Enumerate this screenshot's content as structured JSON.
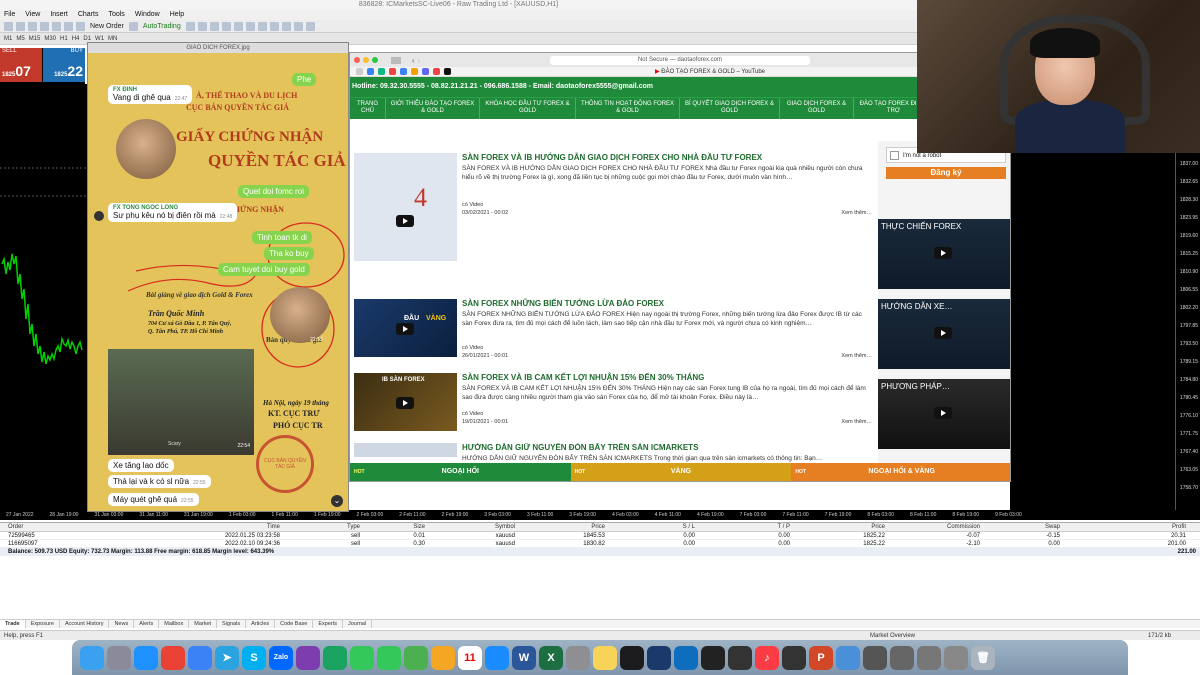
{
  "mt4": {
    "title": "836828: ICMarketsSC-Live06 - Raw Trading Ltd - [XAUUSD,H1]",
    "menu": [
      "File",
      "View",
      "Insert",
      "Charts",
      "Tools",
      "Window",
      "Help"
    ],
    "toolbar": {
      "new_order": "New Order",
      "autotrading": "AutoTrading"
    },
    "timeframes": [
      "M1",
      "M5",
      "M15",
      "M30",
      "H1",
      "H4",
      "D1",
      "W1",
      "MN"
    ],
    "oneclick": {
      "sell_label": "SELL",
      "buy_label": "BUY",
      "lot": "0.01",
      "sell_small": "1825",
      "sell_big": "07",
      "buy_small": "1825",
      "buy_big": "22"
    },
    "price_axis": [
      "1837.00",
      "1832.65",
      "1828.30",
      "1823.95",
      "1819.60",
      "1815.25",
      "1810.90",
      "1806.55",
      "1802.20",
      "1797.85",
      "1793.50",
      "1789.15",
      "1784.80",
      "1780.45",
      "1776.10",
      "1771.75",
      "1767.40",
      "1763.05",
      "1758.70"
    ],
    "time_axis": [
      "27 Jan 2022",
      "28 Jan 19:00",
      "31 Jan 03:00",
      "31 Jan 11:00",
      "31 Jan 19:00",
      "1 Feb 03:00",
      "1 Feb 11:00",
      "1 Feb 19:00",
      "2 Feb 03:00",
      "2 Feb 11:00",
      "2 Feb 19:00",
      "3 Feb 03:00",
      "3 Feb 11:00",
      "3 Feb 19:00",
      "4 Feb 03:00",
      "4 Feb 11:00",
      "4 Feb 19:00",
      "7 Feb 03:00",
      "7 Feb 11:00",
      "7 Feb 19:00",
      "8 Feb 03:00",
      "8 Feb 11:00",
      "8 Feb 19:00",
      "9 Feb 03:00"
    ],
    "terminal": {
      "headers": [
        "Order",
        "Time",
        "Type",
        "Size",
        "Symbol",
        "Price",
        "S / L",
        "T / P",
        "Price",
        "Commission",
        "Swap",
        "Profit"
      ],
      "rows": [
        [
          "72599465",
          "2022.01.25 03:23:58",
          "sell",
          "0.01",
          "xauusd",
          "1845.53",
          "0.00",
          "0.00",
          "1825.22",
          "-0.07",
          "-0.15",
          "20.31"
        ],
        [
          "116695097",
          "2022.02.10 09:24:36",
          "sell",
          "0.30",
          "xauusd",
          "1830.82",
          "0.00",
          "0.00",
          "1825.22",
          "-2.10",
          "0.00",
          "201.00"
        ]
      ],
      "balance": "Balance: 509.73 USD  Equity: 732.73  Margin: 113.88  Free margin: 618.85  Margin level: 643.39%",
      "balance_profit": "221.00",
      "tabs": [
        "Trade",
        "Exposure",
        "Account History",
        "News",
        "Alerts",
        "Mailbox",
        "Market",
        "Signals",
        "Articles",
        "Code Base",
        "Experts",
        "Journal"
      ]
    },
    "status": "Help, press F1",
    "status_right": "Market Overview",
    "status_far": "171/2 kb"
  },
  "photo": {
    "title": "GIAO DICH FOREX.jpg",
    "cert_line1": "À, THỂ THAO VÀ DU LỊCH",
    "cert_line2": "CỤC BẢN QUYỀN TÁC GIẢ",
    "cert_line3": "GIẤY CHỨNG NHẬN",
    "cert_line4": "QUYỀN TÁC GIẢ",
    "cert_line5": "CHỨNG NHẬN",
    "cert_line6": "Bài giảng về giao dịch Gold & Forex",
    "cert_line7": "Trần Quốc Minh",
    "cert_line8": "704 Cư xá Gò Dầu 1, P. Tân Quý,",
    "cert_line9": "Q. Tân Phú, TP. Hồ Chí Minh",
    "cert_line10": "Bản quyền Tác giả",
    "cert_line11": "Hà Nội, ngày 19 tháng",
    "cert_line12": "KT. CỤC TRƯ",
    "cert_line13": "PHÓ CỤC TR",
    "stamp": "CỤC BẢN QUYỀN TÁC GIẢ",
    "chat": {
      "top_right": "Phe",
      "m1_name": "FX ĐINH",
      "m1_text": "Vang di ghê qua",
      "m1_time": "22:47",
      "m2_text": "Quet doi fomc roi",
      "m3_name": "FX TONG NGOC LONG",
      "m3_text": "Sư phụ kêu nó bị điên rồi mà",
      "m3_time": "22:48",
      "m4_text": "Tinh toan tk di",
      "m5_text": "Tha ko buy",
      "m6_text": "Cam tuyet doi buy gold",
      "m7_time": "22:53",
      "video_time": "22:54",
      "video_label": "Scary",
      "m8_text": "Xe tăng lao dốc",
      "m9_text": "Thả lại và k có sl nữa",
      "m9_time": "22:55",
      "m10_text": "Máy quét ghê quá",
      "m10_time": "22:55"
    }
  },
  "browser": {
    "url": "Not Secure — daotaoforex.com",
    "yt_tab": "ĐÀO TẠO FOREX & GOLD – YouTube",
    "hotline": "Hotline: 09.32.30.5555 - 08.82.21.21.21 - 096.686.1588 - Email: daotaoforex5555@gmail.com",
    "nav": [
      "TRANG CHỦ",
      "GIỚI THIỆU ĐÀO TẠO FOREX & GOLD",
      "KHÓA HỌC ĐẦU TƯ FOREX & GOLD",
      "THÔNG TIN HOẠT ĐỘNG FOREX & GOLD",
      "BÍ QUYẾT GIAO DỊCH FOREX & GOLD",
      "GIAO DỊCH FOREX & GOLD",
      "ĐÀO TẠO FOREX ĐI HỖ TRỢ"
    ],
    "articles": [
      {
        "title": "SÀN FOREX VÀ IB HƯỚNG DẪN GIAO DỊCH FOREX CHO NHÀ ĐẦU TƯ FOREX",
        "body": "SÀN FOREX VÀ IB HƯỚNG DẪN GIAO DỊCH FOREX CHO NHÀ ĐẦU TƯ FOREX Nhà đầu tư Forex ngoài kia quá nhiều người còn chưa hiểu rõ về thị trường Forex là gì, xong đã liền tục bị những cuộc gọi mời chào đầu tư Forex, dưới muôn vàn hình…",
        "type": "có Video",
        "date": "03/02/2021 - 00:02",
        "more": "Xem thêm…"
      },
      {
        "title": "SÀN FOREX NHỮNG BIẾN TƯỚNG LỪA ĐẢO FOREX",
        "body": "SÀN FOREX NHỮNG BIẾN TƯỚNG LỪA ĐẢO FOREX  Hiện nay ngoài thị trường Forex, những biến tướng lừa đảo Forex được IB từ các sàn Forex đưa ra, tìm đủ mọi cách để luồn lách, làm sao tiếp cận nhà đầu tư Forex mới, và người chưa có kinh nghiệm…",
        "type": "có Video",
        "date": "26/01/2021 - 00:01",
        "more": "Xem thêm…",
        "thumb_word1": "ĐẦU",
        "thumb_word2": "VÀNG"
      },
      {
        "title": "SÀN FOREX VÀ IB CAM KẾT LỢI NHUẬN 15% ĐẾN 30% THÁNG",
        "body": "SÀN FOREX VÀ IB CAM KẾT LỢI NHUẬN 15% ĐẾN 30% THÁNG  Hiện nay các sàn Forex tung IB của họ ra ngoài, tìm đủ mọi cách để làm sao đưa được càng nhiều người tham gia vào sàn Forex của họ, để mở tài khoản Forex. Điều này là…",
        "type": "có Video",
        "date": "19/01/2021 - 00:01",
        "more": "Xem thêm…",
        "thumb_word1": "IB SÀN FOREX"
      },
      {
        "title": "HƯỚNG DẪN GIỮ NGUYÊN ĐÒN BẨY TRÊN SÀN ICMARKETS",
        "body": "HƯỚNG DẪN GIỮ NGUYÊN ĐÒN BẨY TRÊN SÀN ICMARKETS  Trong thời gian qua trên sàn icmarkets có thông tin: Bạn…"
      }
    ],
    "thumb1_number": "4",
    "captcha": "I'm not a robot",
    "register": "Đăng ký",
    "side_videos": [
      "THỰC CHIẾN FOREX",
      "HƯỚNG DẪN XE…",
      "PHƯƠNG PHÁP…"
    ],
    "bottom": [
      "NGOẠI HỐI",
      "VÀNG",
      "NGOẠI HỐI & VÀNG"
    ],
    "bottom_badge": "HOT"
  },
  "dock": {
    "icons": [
      "finder-icon",
      "launchpad-icon",
      "safari-icon",
      "chrome-icon",
      "edge-icon",
      "telegram-icon",
      "skype-icon",
      "zalo-icon",
      "viber-icon",
      "stacks-icon",
      "facetime-icon",
      "messages-icon",
      "maps-icon",
      "photos-icon",
      "calendar-icon",
      "appstore-icon",
      "word-icon",
      "excel-icon",
      "settings-icon",
      "notes-icon",
      "quicktime-icon",
      "mt4-icon",
      "teamviewer-icon",
      "terminal-icon",
      "obs-icon",
      "music-icon",
      "console-icon",
      "powerpoint-icon",
      "preview-icon",
      "window-thumb-1",
      "window-thumb-2",
      "window-thumb-3",
      "window-thumb-4",
      "trash-icon"
    ],
    "calendar_day": "11",
    "zalo": "Zalo"
  },
  "colors": {
    "site_green": "#1f8a3a",
    "sell_red": "#c0392b",
    "buy_blue": "#1f6fb2",
    "orange": "#e67e22",
    "gold": "#e3c35a",
    "bubble_green": "#86d44d"
  }
}
